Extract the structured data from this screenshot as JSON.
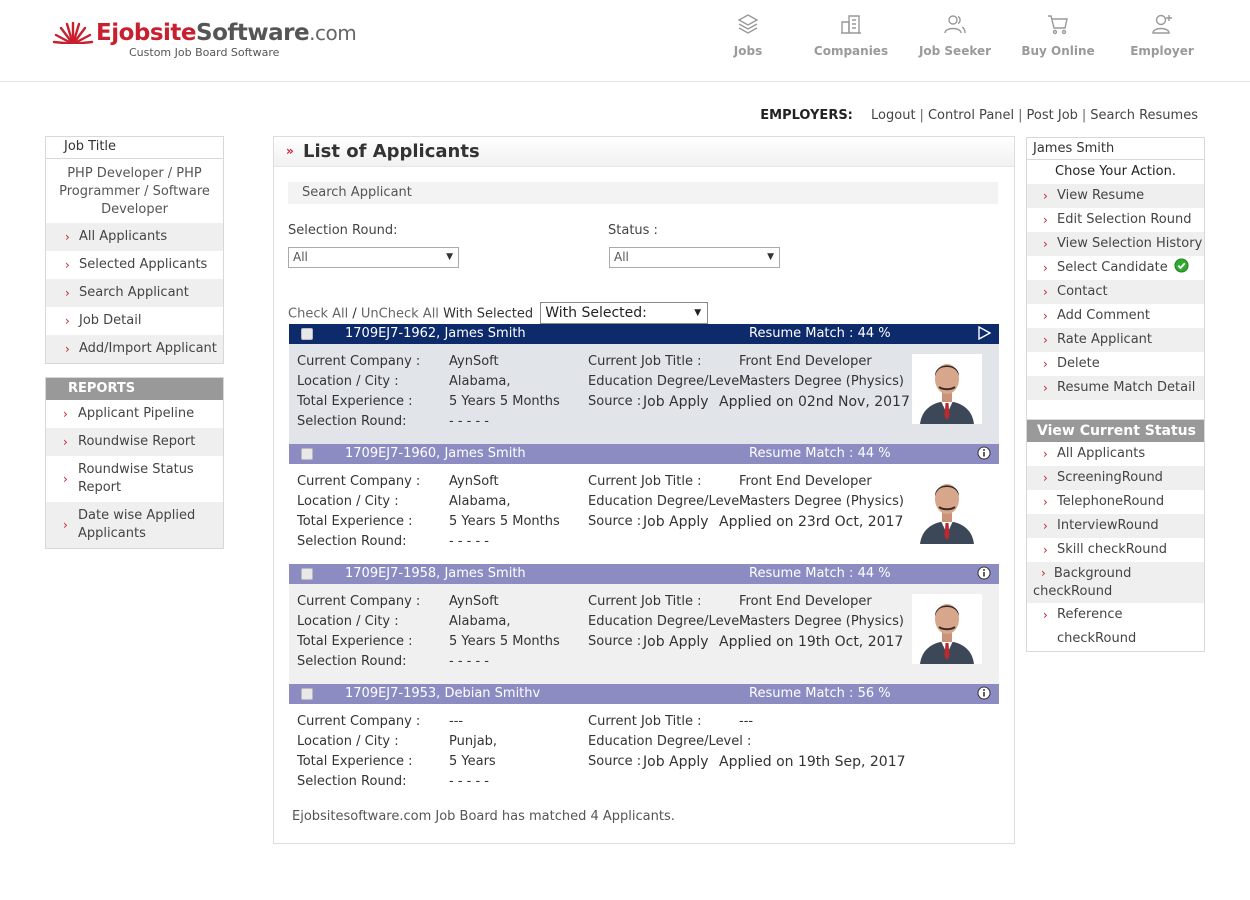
{
  "brand": {
    "name_part1": "Ejobsite",
    "name_part2": "Software",
    "name_part3": ".com",
    "tagline": "Custom Job Board Software"
  },
  "topnav": [
    {
      "label": "Jobs",
      "icon": "layers-icon"
    },
    {
      "label": "Companies",
      "icon": "buildings-icon"
    },
    {
      "label": "Job Seeker",
      "icon": "users-icon"
    },
    {
      "label": "Buy Online",
      "icon": "cart-icon"
    },
    {
      "label": "Employer",
      "icon": "user-add-icon"
    }
  ],
  "employer_bar": {
    "label": "EMPLOYERS:",
    "links": [
      "Logout",
      "Control Panel",
      "Post Job",
      "Search Resumes"
    ],
    "separator": "|"
  },
  "left_sidebar": {
    "header": "Job Title",
    "job_name": "PHP Developer / PHP Programmer / Software Developer",
    "items": [
      "All Applicants",
      "Selected Applicants",
      "Search Applicant",
      "Job Detail",
      "Add/Import Applicant"
    ],
    "reports_header": "REPORTS",
    "reports": [
      "Applicant Pipeline",
      "Roundwise Report",
      "Roundwise Status Report",
      "Date wise Applied Applicants"
    ]
  },
  "main": {
    "title": "List of Applicants",
    "search_label": "Search Applicant",
    "selection_round_label": "Selection Round:",
    "selection_round_value": "All",
    "status_label": "Status :",
    "status_value": "All",
    "check_all": "Check All",
    "slash": "/",
    "uncheck_all": "UnCheck All",
    "with_selected_label": "With Selected",
    "with_selected_value": "With Selected:",
    "field_labels": {
      "company": "Current Company :",
      "location": "Location / City :",
      "experience": "Total Experience :",
      "round": "Selection Round:",
      "job_title": "Current Job Title :",
      "education": "Education Degree/Level :",
      "source": "Source :"
    },
    "applicants": [
      {
        "id_name": "1709EJ7-1962, James Smith",
        "match": "Resume Match : 44 %",
        "company": "AynSoft",
        "location": "Alabama,",
        "experience": "5 Years 5 Months",
        "round": "- - - - -",
        "job_title": "Front End Developer",
        "education": "Masters Degree (Physics)",
        "source": "Job Apply",
        "applied": "Applied on 02nd Nov, 2017",
        "has_photo": true,
        "highlight": true
      },
      {
        "id_name": "1709EJ7-1960, James Smith",
        "match": "Resume Match : 44 %",
        "company": "AynSoft",
        "location": "Alabama,",
        "experience": "5 Years 5 Months",
        "round": "- - - - -",
        "job_title": "Front End Developer",
        "education": "Masters Degree (Physics)",
        "source": "Job Apply",
        "applied": "Applied on 23rd Oct, 2017",
        "has_photo": true,
        "highlight": false
      },
      {
        "id_name": "1709EJ7-1958, James Smith",
        "match": "Resume Match : 44 %",
        "company": "AynSoft",
        "location": "Alabama,",
        "experience": "5 Years 5 Months",
        "round": "- - - - -",
        "job_title": "Front End Developer",
        "education": "Masters Degree (Physics)",
        "source": "Job Apply",
        "applied": "Applied on 19th Oct, 2017",
        "has_photo": true,
        "highlight": false
      },
      {
        "id_name": "1709EJ7-1953, Debian Smithv",
        "match": "Resume Match : 56 %",
        "company": "---",
        "location": "Punjab,",
        "experience": "5 Years",
        "round": "- - - - -",
        "job_title": "---",
        "education": "",
        "source": "Job Apply",
        "applied": "Applied on 19th Sep, 2017",
        "has_photo": false,
        "highlight": false
      }
    ],
    "footnote": "Ejobsitesoftware.com Job Board has matched 4 Applicants."
  },
  "right_sidebar": {
    "header": "James Smith",
    "subheader": "Chose Your Action.",
    "actions": [
      "View Resume",
      "Edit Selection Round",
      "View Selection History",
      "Select Candidate",
      "Contact",
      "Add Comment",
      "Rate Applicant",
      "Delete",
      "Resume Match Detail"
    ],
    "status_header": "View Current Status",
    "statuses": [
      "All Applicants",
      "ScreeningRound",
      "TelephoneRound",
      "InterviewRound",
      "Skill checkRound",
      "Background checkRound",
      "Reference checkRound"
    ]
  },
  "colors": {
    "brand_red": "#c8202f",
    "bar_active": "#0d2a6b",
    "bar_inactive": "#8c8cc3",
    "row_active_bg": "#e1e4e9",
    "row_alt_bg": "#f0f0f0",
    "check_green": "#2eaa2e"
  }
}
